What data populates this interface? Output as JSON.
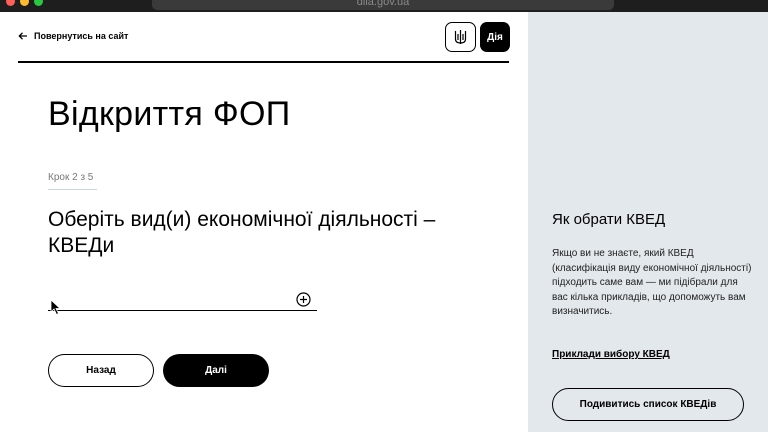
{
  "browser": {
    "url": "diia.gov.ua"
  },
  "header": {
    "back_link": "Повернутись на сайт",
    "logo_diia": "Дія"
  },
  "main": {
    "title": "Відкриття ФОП",
    "step": "Крок 2 з 5",
    "question": "Оберіть вид(и) економічної діяльності – КВЕДи",
    "kved_field": {
      "value": "",
      "placeholder": ""
    },
    "buttons": {
      "back": "Назад",
      "next": "Далі"
    }
  },
  "aside": {
    "title": "Як обрати КВЕД",
    "text": "Якщо ви не знаєте, який КВЕД (класифікація виду економічної діяльності) підходить саме вам — ми підібрали для вас кілька прикладів, що допоможуть вам визначитись.",
    "examples_link": "Приклади вибору КВЕД",
    "list_button": "Подивитись список КВЕДів"
  },
  "colors": {
    "aside_bg": "#e3e8ec",
    "primary": "#000000"
  }
}
